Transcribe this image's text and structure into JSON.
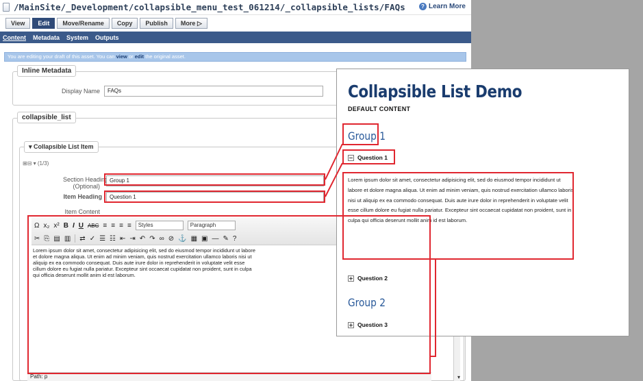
{
  "cms": {
    "path": "/MainSite/_Development/collapsible_menu_test_061214/_collapsible_lists/FAQs",
    "learn_more": "Learn More",
    "tabs": [
      "View",
      "Edit",
      "Move/Rename",
      "Copy",
      "Publish",
      "More"
    ],
    "subtabs": [
      "Content",
      "Metadata",
      "System",
      "Outputs"
    ],
    "notice": {
      "before": "You are editing your draft of this asset. You can ",
      "view": "view",
      "or": " or ",
      "edit": "edit",
      "after": " the original asset."
    },
    "inline_metadata": {
      "legend": "Inline Metadata",
      "display_name_label": "Display Name",
      "display_name_value": "FAQs"
    },
    "collapsible_list": {
      "legend": "collapsible_list",
      "item_legend": "Collapsible List Item",
      "item_count": "(1/3)",
      "section_heading_label": "Section Heading",
      "section_heading_optional": "(Optional)",
      "section_heading_value": "Group 1",
      "item_heading_label": "Item Heading",
      "item_heading_value": "Question 1",
      "item_content_label": "Item Content"
    },
    "editor": {
      "styles_label": "Styles",
      "format_label": "Paragraph",
      "body": "Lorem ipsum dolor sit amet, consectetur adipisicing elit, sed do eiusmod tempor incididunt ut labore et dolore magna aliqua. Ut enim ad minim veniam, quis nostrud exercitation ullamco laboris nisi ut aliquip ex ea commodo consequat. Duis aute irure dolor in reprehenderit in voluptate velit esse cillum dolore eu fugiat nulla pariatur. Excepteur sint occaecat cupidatat non proident, sunt in culpa qui officia deserunt mollit anim id est laborum.",
      "path": "Path: p"
    }
  },
  "preview": {
    "title": "Collapsible List Demo",
    "subtitle": "DEFAULT CONTENT",
    "group1": "Group 1",
    "q1": "Question 1",
    "body": "Lorem ipsum dolor sit amet, consectetur adipisicing elit, sed do eiusmod tempor incididunt ut labore et dolore magna aliqua. Ut enim ad minim veniam, quis nostrud exercitation ullamco laboris nisi ut aliquip ex ea commodo consequat. Duis aute irure dolor in reprehenderit in voluptate velit esse cillum dolore eu fugiat nulla pariatur. Excepteur sint occaecat cupidatat non proident, sunt in culpa qui officia deserunt mollit anim id est laborum.",
    "q2": "Question 2",
    "group2": "Group 2",
    "q3": "Question 3"
  },
  "colors": {
    "annotation_red": "#e0262f",
    "nav_blue": "#3b5a8a",
    "heading_blue": "#1a3c6e"
  }
}
